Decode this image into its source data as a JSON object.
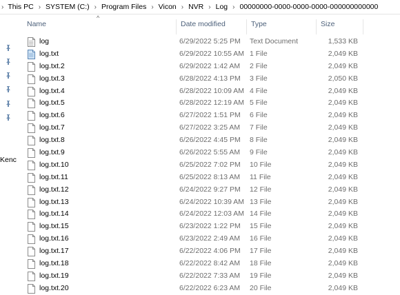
{
  "breadcrumb": [
    "This PC",
    "SYSTEM (C:)",
    "Program Files",
    "Vicon",
    "NVR",
    "Log",
    "00000000-0000-0000-0000-000000000000"
  ],
  "nav_fragment": "Kenc",
  "columns": {
    "name": "Name",
    "date": "Date modified",
    "type": "Type",
    "size": "Size"
  },
  "sort_indicator": "^",
  "files": [
    {
      "name": "log",
      "date": "6/29/2022 5:25 PM",
      "type": "Text Document",
      "size": "1,533 KB",
      "icon": "text-document-icon"
    },
    {
      "name": "log.txt",
      "date": "6/29/2022 10:55 AM",
      "type": "1 File",
      "size": "2,049 KB",
      "icon": "text-file-blue-icon"
    },
    {
      "name": "log.txt.2",
      "date": "6/29/2022 1:42 AM",
      "type": "2 File",
      "size": "2,049 KB",
      "icon": "blank-file-icon"
    },
    {
      "name": "log.txt.3",
      "date": "6/28/2022 4:13 PM",
      "type": "3 File",
      "size": "2,050 KB",
      "icon": "blank-file-icon"
    },
    {
      "name": "log.txt.4",
      "date": "6/28/2022 10:09 AM",
      "type": "4 File",
      "size": "2,049 KB",
      "icon": "blank-file-icon"
    },
    {
      "name": "log.txt.5",
      "date": "6/28/2022 12:19 AM",
      "type": "5 File",
      "size": "2,049 KB",
      "icon": "blank-file-icon"
    },
    {
      "name": "log.txt.6",
      "date": "6/27/2022 1:51 PM",
      "type": "6 File",
      "size": "2,049 KB",
      "icon": "blank-file-icon"
    },
    {
      "name": "log.txt.7",
      "date": "6/27/2022 3:25 AM",
      "type": "7 File",
      "size": "2,049 KB",
      "icon": "blank-file-icon"
    },
    {
      "name": "log.txt.8",
      "date": "6/26/2022 4:45 PM",
      "type": "8 File",
      "size": "2,049 KB",
      "icon": "blank-file-icon"
    },
    {
      "name": "log.txt.9",
      "date": "6/26/2022 5:55 AM",
      "type": "9 File",
      "size": "2,049 KB",
      "icon": "blank-file-icon"
    },
    {
      "name": "log.txt.10",
      "date": "6/25/2022 7:02 PM",
      "type": "10 File",
      "size": "2,049 KB",
      "icon": "blank-file-icon"
    },
    {
      "name": "log.txt.11",
      "date": "6/25/2022 8:13 AM",
      "type": "11 File",
      "size": "2,049 KB",
      "icon": "blank-file-icon"
    },
    {
      "name": "log.txt.12",
      "date": "6/24/2022 9:27 PM",
      "type": "12 File",
      "size": "2,049 KB",
      "icon": "blank-file-icon"
    },
    {
      "name": "log.txt.13",
      "date": "6/24/2022 10:39 AM",
      "type": "13 File",
      "size": "2,049 KB",
      "icon": "blank-file-icon"
    },
    {
      "name": "log.txt.14",
      "date": "6/24/2022 12:03 AM",
      "type": "14 File",
      "size": "2,049 KB",
      "icon": "blank-file-icon"
    },
    {
      "name": "log.txt.15",
      "date": "6/23/2022 1:22 PM",
      "type": "15 File",
      "size": "2,049 KB",
      "icon": "blank-file-icon"
    },
    {
      "name": "log.txt.16",
      "date": "6/23/2022 2:49 AM",
      "type": "16 File",
      "size": "2,049 KB",
      "icon": "blank-file-icon"
    },
    {
      "name": "log.txt.17",
      "date": "6/22/2022 4:06 PM",
      "type": "17 File",
      "size": "2,049 KB",
      "icon": "blank-file-icon"
    },
    {
      "name": "log.txt.18",
      "date": "6/22/2022 8:42 AM",
      "type": "18 File",
      "size": "2,049 KB",
      "icon": "blank-file-icon"
    },
    {
      "name": "log.txt.19",
      "date": "6/22/2022 7:33 AM",
      "type": "19 File",
      "size": "2,049 KB",
      "icon": "blank-file-icon"
    },
    {
      "name": "log.txt.20",
      "date": "6/22/2022 6:23 AM",
      "type": "20 File",
      "size": "2,049 KB",
      "icon": "blank-file-icon"
    }
  ],
  "colors": {
    "header_text": "#4c607a",
    "secondary_text": "#6d6d6d",
    "pin": "#6b8bb0"
  }
}
